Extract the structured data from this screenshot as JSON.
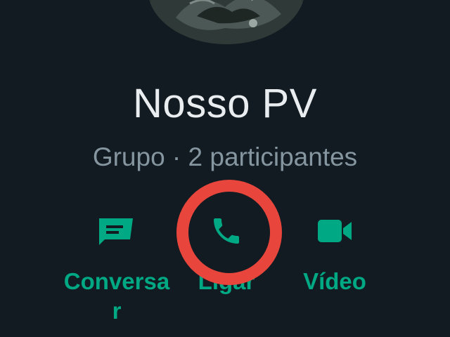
{
  "group": {
    "name": "Nosso PV",
    "subtitle": "Grupo · 2 participantes"
  },
  "actions": [
    {
      "label": "Conversar",
      "icon": "message-icon"
    },
    {
      "label": "Ligar",
      "icon": "phone-icon"
    },
    {
      "label": "Vídeo",
      "icon": "video-camera-icon"
    }
  ],
  "colors": {
    "background": "#111b21",
    "accent": "#00a884",
    "title": "#e9edef",
    "subtitle": "#8696a0",
    "highlight_ring": "#e8463c"
  }
}
